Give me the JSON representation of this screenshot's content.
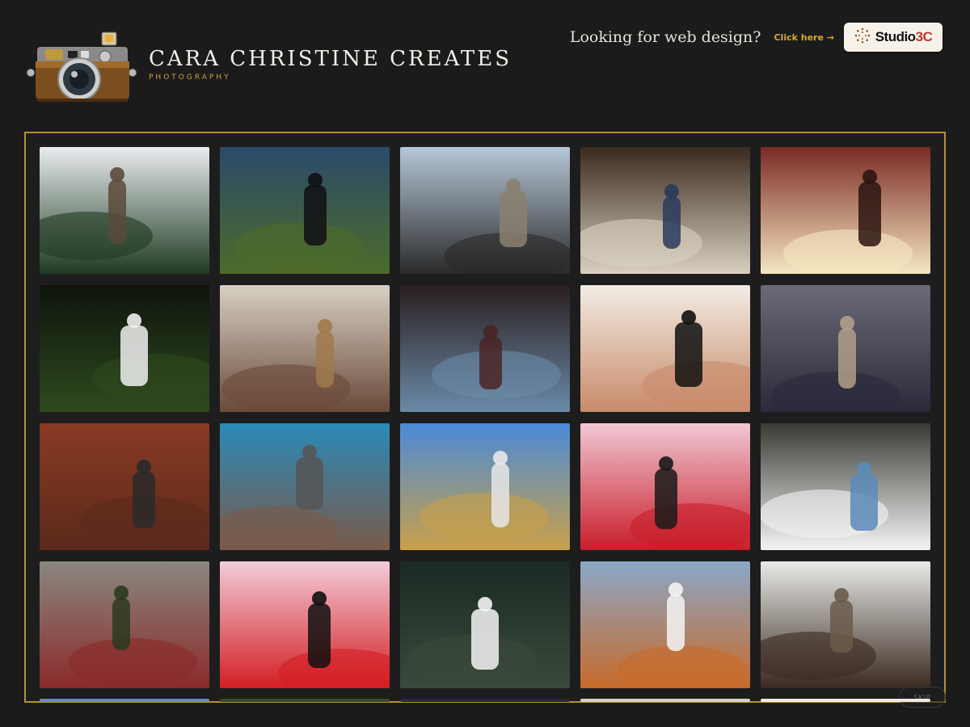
{
  "brand": {
    "title": "CARA CHRISTINE CREATES",
    "subtitle": "PHOTOGRAPHY",
    "logo_icon": "vintage-camera-icon"
  },
  "promo": {
    "text": "Looking for web design?",
    "link_label": "Click here →",
    "studio_name_main": "Studio",
    "studio_name_accent": "3C",
    "studio_icon": "sunburst-icon",
    "accent_color": "#c9a23a"
  },
  "gallery": {
    "frame_color": "#b8902c",
    "photos": [
      {
        "id": "woman-green-dress-snow-creek",
        "palette": [
          "#e9ecef",
          "#1f3b22",
          "#5a4a3a"
        ]
      },
      {
        "id": "veiled-figure-glowing-orb-forest",
        "palette": [
          "#2b4a6a",
          "#4c6b2a",
          "#0f0f14"
        ]
      },
      {
        "id": "couple-under-pergola-wreath",
        "palette": [
          "#b6c8d8",
          "#2a2a2a",
          "#8a8070"
        ]
      },
      {
        "id": "friends-restaurant-here-sign",
        "palette": [
          "#3a2a1e",
          "#d8d0c0",
          "#2a3a5a"
        ]
      },
      {
        "id": "woman-sparklers-red-wall",
        "palette": [
          "#7a2a24",
          "#f5e6c0",
          "#2a1410"
        ]
      },
      {
        "id": "dark-forest-hooded-figure-orb",
        "palette": [
          "#0e140c",
          "#2e4a1e",
          "#f0f0f0"
        ]
      },
      {
        "id": "toddler-wooden-blocks-waiting-room",
        "palette": [
          "#d8d0c4",
          "#6a4a3a",
          "#a07a4a"
        ]
      },
      {
        "id": "figure-glowing-orb-doorway",
        "palette": [
          "#2a1e1e",
          "#6a8aa8",
          "#4a2424"
        ]
      },
      {
        "id": "legs-polka-socks-heels",
        "palette": [
          "#f2ece4",
          "#c88a6a",
          "#111111"
        ]
      },
      {
        "id": "toddler-connect-four-game",
        "palette": [
          "#6a6a78",
          "#2a2a3a",
          "#b0a08a"
        ]
      },
      {
        "id": "woman-rusty-brick-wall-beams",
        "palette": [
          "#8a3a24",
          "#5a2a1a",
          "#2a2a2a"
        ]
      },
      {
        "id": "woman-graffiti-brick-wall",
        "palette": [
          "#2a8ab8",
          "#7a5a4a",
          "#555555"
        ]
      },
      {
        "id": "woman-rainbow-barn-sky",
        "palette": [
          "#4a8ad8",
          "#c8a04a",
          "#e8e8e8"
        ]
      },
      {
        "id": "woman-red-balloons-pink-wall",
        "palette": [
          "#f0c8d4",
          "#c81e2a",
          "#1a1a1a"
        ]
      },
      {
        "id": "white-dress-railroad-tracks",
        "palette": [
          "#3a3a34",
          "#f4f4f4",
          "#5a8ab8"
        ]
      },
      {
        "id": "woman-old-building-graffiti-door",
        "palette": [
          "#8a8880",
          "#8a2a2a",
          "#2a3a1e"
        ]
      },
      {
        "id": "red-balloons-pink-backdrop",
        "palette": [
          "#f2ccd8",
          "#d41e24",
          "#111111"
        ]
      },
      {
        "id": "veiled-figure-forest-orb",
        "palette": [
          "#1a2a24",
          "#3a4a3a",
          "#f4f4f4"
        ]
      },
      {
        "id": "woman-white-dress-autumn-tracks",
        "palette": [
          "#8aa8c8",
          "#c86a2a",
          "#f4f4f4"
        ]
      },
      {
        "id": "covered-bridge-snow",
        "palette": [
          "#e8eae8",
          "#3a2a20",
          "#6a5a4a"
        ]
      }
    ]
  },
  "skip_label": "SKIP"
}
